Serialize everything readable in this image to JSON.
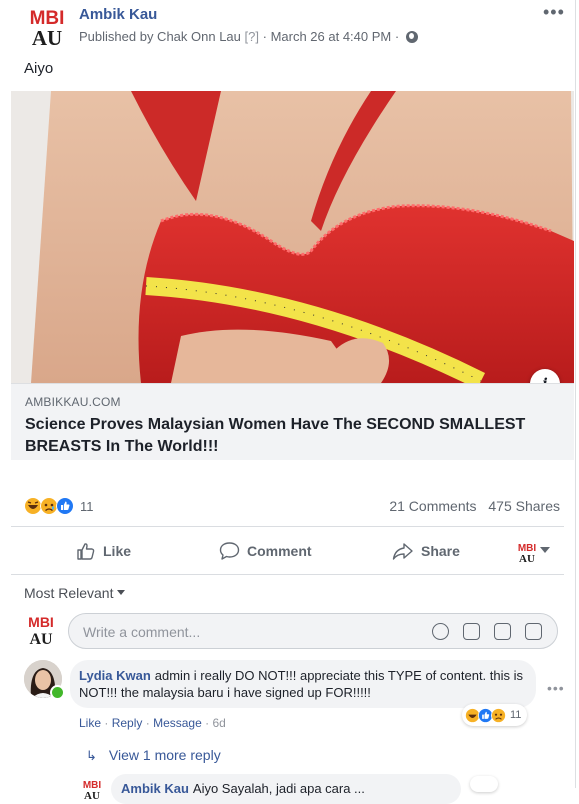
{
  "post": {
    "page_name": "Ambik Kau",
    "published_by": "Published by Chak Onn Lau",
    "help_mark": "[?]",
    "timestamp": "March 26 at 4:40 PM",
    "text": "Aiyo",
    "logo_top": "MBI",
    "logo_bottom": "AU"
  },
  "link": {
    "domain": "AMBIKKAU.COM",
    "title": "Science Proves Malaysian Women Have The SECOND SMALLEST BREASTS In The World!!!",
    "info_label": "i"
  },
  "reactions": {
    "types": [
      "haha",
      "sad",
      "like"
    ],
    "count": "11",
    "comments": "21 Comments",
    "shares": "475 Shares"
  },
  "actions": {
    "like": "Like",
    "comment": "Comment",
    "share": "Share"
  },
  "comments_section": {
    "sort_label": "Most Relevant",
    "input_placeholder": "Write a comment..."
  },
  "comment": {
    "author": "Lydia Kwan",
    "text": "admin i really DO NOT!!! appreciate this TYPE of content. this is NOT!!! the malaysia baru i have signed up FOR!!!!!",
    "like": "Like",
    "reply": "Reply",
    "message": "Message",
    "age": "6d",
    "reaction_count": "11"
  },
  "replies": {
    "view_more": "View 1 more reply",
    "reply_author": "Ambik Kau",
    "reply_text": "Aiyo Sayalah, jadi apa cara ..."
  },
  "colors": {
    "link_blue": "#385898",
    "meta_grey": "#616770",
    "like_blue": "#2078f4",
    "emoji_yellow": "#f7b125",
    "online_green": "#42b72a"
  }
}
